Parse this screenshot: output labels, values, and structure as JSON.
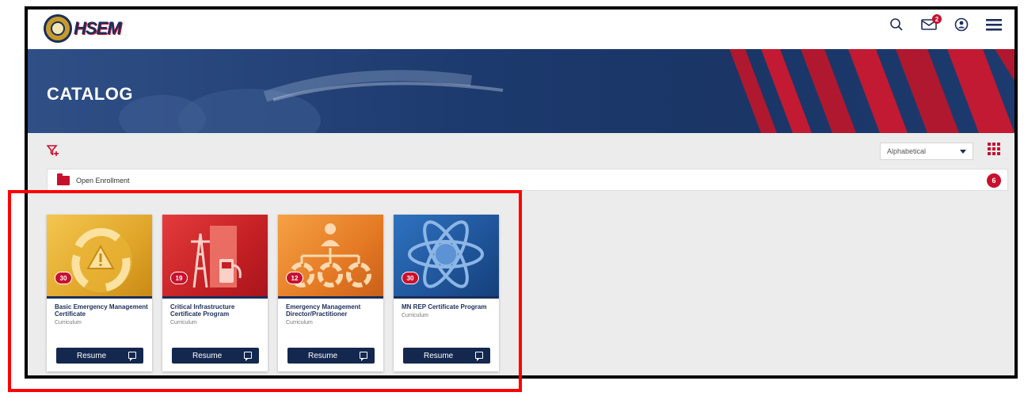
{
  "header": {
    "logo_text": "HSEM",
    "message_badge": "2"
  },
  "hero": {
    "title": "CATALOG"
  },
  "toolbar": {
    "sort_value": "Alphabetical"
  },
  "folder": {
    "label": "Open Enrollment",
    "count": "6"
  },
  "cards": [
    {
      "title": "Basic Emergency Management Certificate",
      "type": "Curriculum",
      "count": "30",
      "button": "Resume",
      "color_top": "#f2c04a",
      "color_bottom": "#c98a14",
      "icon": "recycle-warning-icon"
    },
    {
      "title": "Critical Infrastructure Certificate Program",
      "type": "Curriculum",
      "count": "19",
      "button": "Resume",
      "color_top": "#e0393b",
      "color_bottom": "#a8151c",
      "icon": "power-tower-fuel-icon"
    },
    {
      "title": "Emergency Management Director/Practitioner",
      "type": "Curriculum",
      "count": "12",
      "button": "Resume",
      "color_top": "#f59a3c",
      "color_bottom": "#c9601a",
      "icon": "org-chart-icon"
    },
    {
      "title": "MN REP Certificate Program",
      "type": "Curriculum",
      "count": "30",
      "button": "Resume",
      "color_top": "#2b6ab8",
      "color_bottom": "#163f7a",
      "icon": "atom-icon"
    }
  ],
  "colors": {
    "accent": "#c8102e",
    "navy": "#14284f",
    "highlight_box": "#ff0000"
  }
}
